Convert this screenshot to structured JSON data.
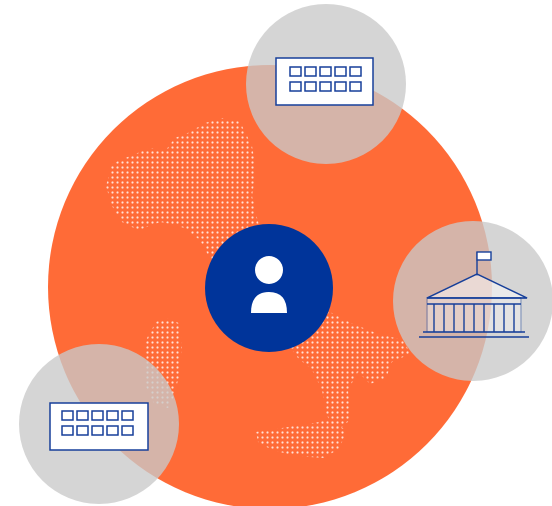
{
  "colors": {
    "background": "#ffffff",
    "main_circle": "#ff6b37",
    "satellite_circle": "#c9c9c9",
    "center_badge": "#00349a",
    "icon_stroke": "#163f9a",
    "map_dots": "#ffffff"
  },
  "icons": {
    "center": "user-icon",
    "top": "keyboard-icon",
    "right": "government-building-icon",
    "bottom_left": "keyboard-icon"
  },
  "map": "italy-dotted-map"
}
